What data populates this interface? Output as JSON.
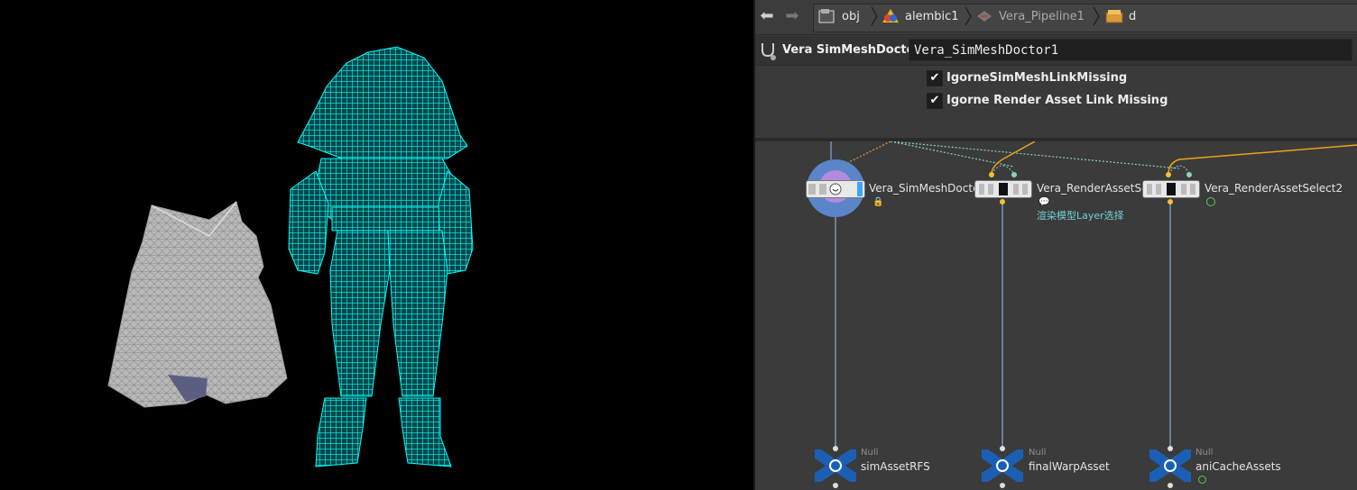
{
  "viewport": {
    "wire_color": "#00ffff",
    "mesh_color": "#c8c8c8",
    "background": "#000000"
  },
  "toolbar": {
    "back_icon": "arrow-left-icon",
    "forward_icon": "arrow-right-icon",
    "breadcrumbs": [
      {
        "label": "obj",
        "icon": "obj-context-icon"
      },
      {
        "label": "alembic1",
        "icon": "alembic-icon"
      },
      {
        "label": "Vera_Pipeline1",
        "icon": "pipeline-icon"
      },
      {
        "label": "d",
        "icon": "folder-box-icon"
      }
    ]
  },
  "parameters": {
    "node_type": "Vera SimMeshDoctor",
    "node_name": "Vera_SimMeshDoctor1",
    "checkboxes": [
      {
        "label": "IgorneSimMeshLinkMissing",
        "checked": true
      },
      {
        "label": "Igorne Render Asset Link Missing",
        "checked": true
      }
    ]
  },
  "network": {
    "nodes": [
      {
        "name": "Vera_SimMeshDoctor",
        "selected": true
      },
      {
        "name": "Vera_RenderAssetSe",
        "comment": "渲染模型Layer选择"
      },
      {
        "name": "Vera_RenderAssetSelect2"
      }
    ],
    "nulls": [
      {
        "type": "Null",
        "name": "simAssetRFS"
      },
      {
        "type": "Null",
        "name": "finalWarpAsset"
      },
      {
        "type": "Null",
        "name": "aniCacheAssets"
      }
    ],
    "colors": {
      "wire": "#7b94b3",
      "dashed_wire": "#d9a43a",
      "orange_wire": "#e8a21c",
      "selected_ring": "#5a86c9",
      "null_icon": "#1b5fb5"
    }
  }
}
